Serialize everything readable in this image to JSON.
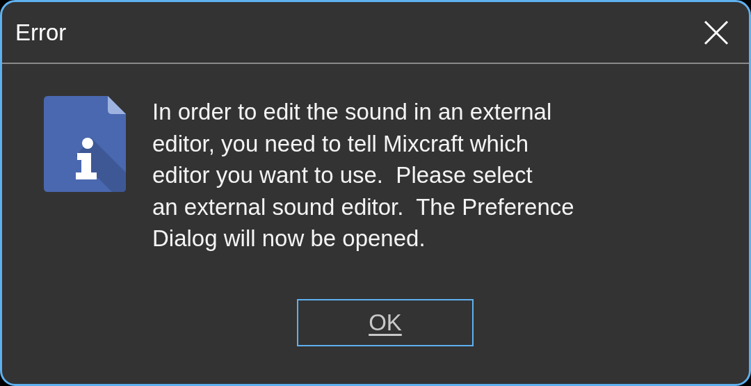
{
  "window": {
    "title": "Error"
  },
  "message": "In order to edit the sound in an external\neditor, you need to tell Mixcraft which\neditor you want to use.  Please select\nan external sound editor.  The Preference\nDialog will now be opened.",
  "buttons": [
    {
      "label": "OK",
      "focused": true
    }
  ]
}
